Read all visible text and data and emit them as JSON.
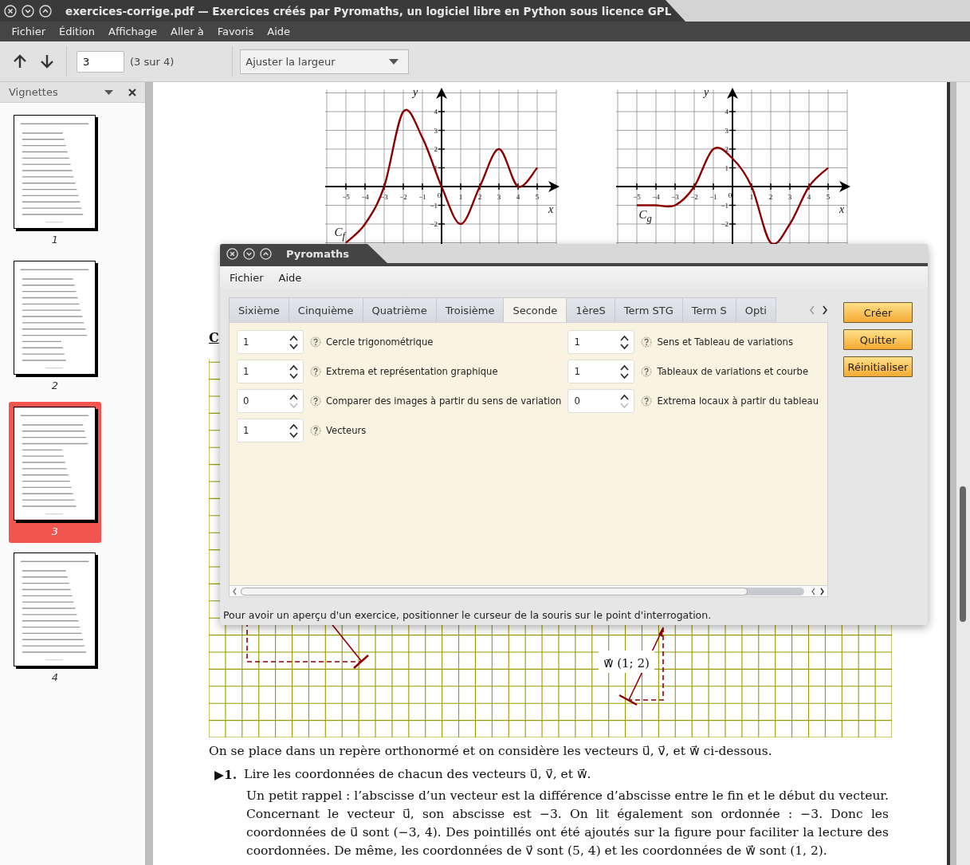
{
  "window": {
    "title": "exercices-corrige.pdf — Exercices créés par Pyromaths, un logiciel libre en Python sous licence GPL"
  },
  "menu": [
    "Fichier",
    "Édition",
    "Affichage",
    "Aller à",
    "Favoris",
    "Aide"
  ],
  "toolbar": {
    "page": "3",
    "page_count": "(3 sur 4)",
    "zoom": "Ajuster la largeur"
  },
  "sidebar": {
    "title": "Vignettes",
    "thumbnails": [
      {
        "label": "1",
        "selected": false
      },
      {
        "label": "2",
        "selected": false
      },
      {
        "label": "3",
        "selected": true
      },
      {
        "label": "4",
        "selected": false
      }
    ]
  },
  "document": {
    "charts": [
      {
        "chart_data": {
          "type": "line",
          "xlabel": "x",
          "ylabel": "y",
          "x": [
            -5,
            -4,
            -3,
            -2,
            -1,
            0,
            1,
            2,
            3,
            4,
            5
          ],
          "series": [
            {
              "name": "C$_{f}$",
              "color": "#8b0000",
              "values": [
                -3,
                -2,
                0,
                4,
                2.6,
                0,
                -2,
                0,
                2,
                0,
                1
              ]
            }
          ],
          "xlim": [
            -6,
            6
          ],
          "ylim": [
            -3,
            5
          ],
          "xticks": [
            -5,
            -4,
            -3,
            -2,
            -1,
            0,
            1,
            2,
            3,
            4,
            5
          ],
          "yticks": [
            -2,
            -1,
            1,
            2,
            3,
            4
          ],
          "grid": true
        }
      },
      {
        "chart_data": {
          "type": "line",
          "xlabel": "x",
          "ylabel": "y",
          "x": [
            -5,
            -4,
            -3,
            -2,
            -1,
            0,
            1,
            2,
            3,
            4,
            5
          ],
          "series": [
            {
              "name": "C$_{g}$",
              "color": "#8b0000",
              "values": [
                -1,
                -1,
                -1,
                0,
                2,
                1.5,
                0,
                -3,
                -2,
                0,
                1
              ]
            }
          ],
          "xlim": [
            -6,
            6
          ],
          "ylim": [
            -3,
            5
          ],
          "xticks": [
            -5,
            -4,
            -3,
            -2,
            -1,
            0,
            1,
            2,
            3,
            4,
            5
          ],
          "yticks": [
            -2,
            -1,
            1,
            2,
            3,
            4
          ],
          "grid": true
        }
      }
    ],
    "heading": "C",
    "figure": {
      "vector_label": "w⃗ (1; 2)"
    },
    "intro": "On se place dans un repère orthonormé et on considère les vecteurs u⃗, v⃗, et w⃗ ci-dessous.",
    "questions": [
      {
        "marker": "▶1.",
        "text": "Lire les coordonnées de chacun des vecteurs u⃗, v⃗, et w⃗.",
        "explanation": "Un petit rappel : l’abscisse d’un vecteur est la différence d’abscisse entre le fin et le début du vecteur. Concernant le vecteur u⃗, son abscisse est −3. On lit également son ordonnée : −3. Donc les coordonnées de u⃗ sont (−3, 4). Des pointillés ont été ajoutés sur la figure pour faciliter la lecture des coordonnées. De même, les coordonnées de v⃗ sont (5, 4) et les coordonnées de w⃗ sont (1, 2)."
      }
    ]
  },
  "dialog": {
    "title": "Pyromaths",
    "menu": [
      "Fichier",
      "Aide"
    ],
    "tabs": [
      {
        "label": "Sixième",
        "selected": false
      },
      {
        "label": "Cinquième",
        "selected": false
      },
      {
        "label": "Quatrième",
        "selected": false
      },
      {
        "label": "Troisième",
        "selected": false
      },
      {
        "label": "Seconde",
        "selected": true
      },
      {
        "label": "1èreS",
        "selected": false
      },
      {
        "label": "Term STG",
        "selected": false
      },
      {
        "label": "Term S",
        "selected": false
      },
      {
        "label": "Opti",
        "selected": false
      }
    ],
    "exercises": [
      {
        "count": "1",
        "label": "Cercle trigonométrique",
        "down_disabled": false
      },
      {
        "count": "1",
        "label": "Sens et Tableau de variations",
        "down_disabled": false
      },
      {
        "count": "1",
        "label": "Extrema et représentation graphique",
        "down_disabled": false
      },
      {
        "count": "1",
        "label": "Tableaux de variations et courbe",
        "down_disabled": false
      },
      {
        "count": "0",
        "label": "Comparer des images à partir du sens de variation",
        "down_disabled": true
      },
      {
        "count": "0",
        "label": "Extrema locaux à partir du tableau",
        "down_disabled": true
      },
      {
        "count": "1",
        "label": "Vecteurs",
        "down_disabled": false
      }
    ],
    "buttons": [
      "Créer",
      "Quitter",
      "Réinitialiser"
    ],
    "status": "Pour avoir un aperçu d'un exercice, positionner le curseur de la souris sur le point d'interrogation."
  }
}
